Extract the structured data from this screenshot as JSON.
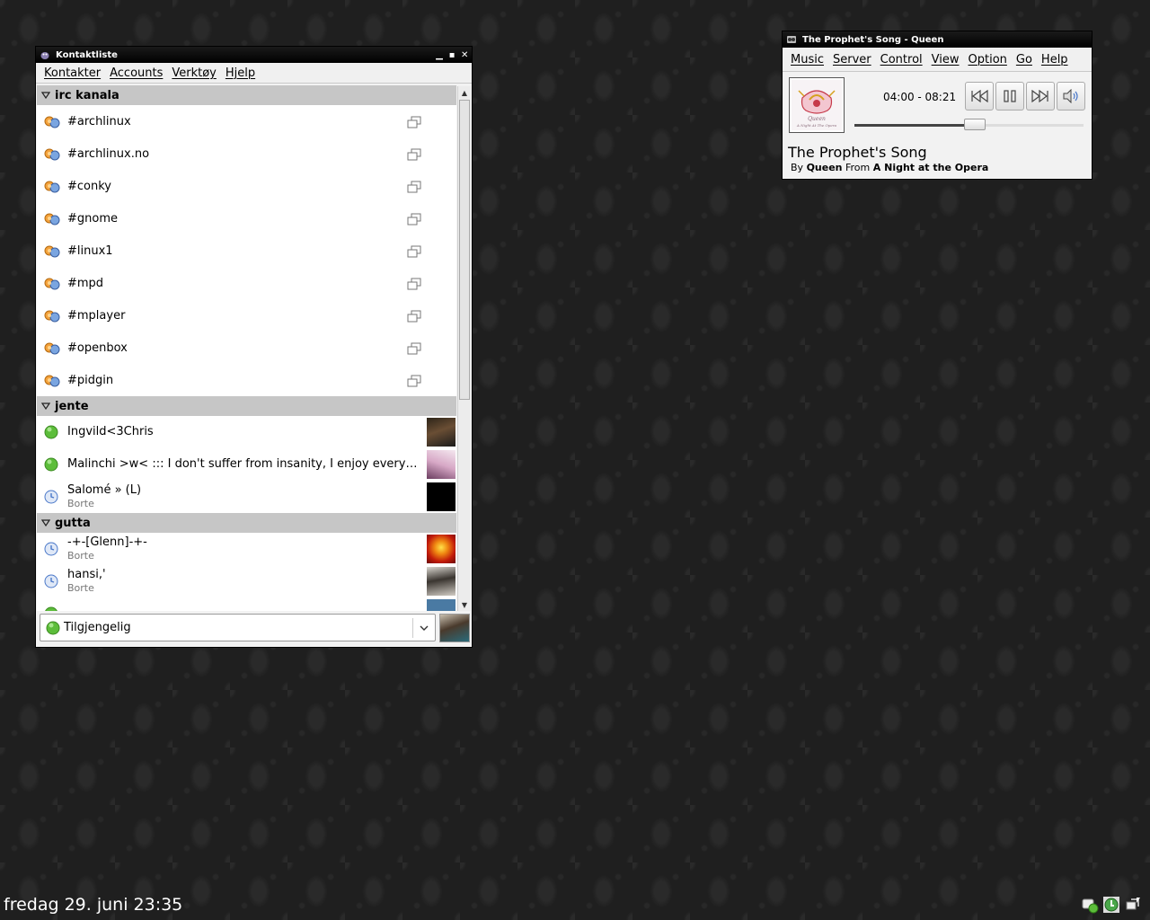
{
  "contact_window": {
    "title": "Kontaktliste",
    "menu": [
      "Kontakter",
      "Accounts",
      "Verktøy",
      "Hjelp"
    ],
    "groups": [
      {
        "name": "irc kanala",
        "channels": [
          "#archlinux",
          "#archlinux.no",
          "#conky",
          "#gnome",
          "#linux1",
          "#mpd",
          "#mplayer",
          "#openbox",
          "#pidgin"
        ]
      },
      {
        "name": "jente",
        "buddies": [
          {
            "name": "Ingvild<3Chris",
            "status": "available",
            "sub": ""
          },
          {
            "name": "Malinchi >w< ::: I don't suffer from insanity, I enjoy every m...",
            "status": "available",
            "sub": ""
          },
          {
            "name": "Salomé  » (L)",
            "status": "away",
            "sub": "Borte"
          }
        ]
      },
      {
        "name": "gutta",
        "buddies": [
          {
            "name": "-+-[Glenn]-+-",
            "status": "away",
            "sub": "Borte"
          },
          {
            "name": "hansi,'",
            "status": "away",
            "sub": "Borte"
          }
        ]
      }
    ],
    "status_selector": {
      "label": "Tilgjengelig"
    }
  },
  "player_window": {
    "title": "The Prophet's Song - Queen",
    "menu": [
      "Music",
      "Server",
      "Control",
      "View",
      "Option",
      "Go",
      "Help"
    ],
    "time": "04:00 - 08:21",
    "progress": 0.479,
    "song_title": "The Prophet's Song",
    "by_label": "By",
    "artist": "Queen",
    "from_label": "From",
    "album": "A Night at the Opera",
    "cover_text_1": "Queen",
    "cover_text_2": "A Night At The Opera"
  },
  "taskbar": {
    "clock": "fredag 29. juni 23:35"
  },
  "colors": {
    "available": "#5cbd3a",
    "away": "#4a78c9",
    "group_header": "#c6c6c6",
    "desktop": "#1f1f1f"
  }
}
